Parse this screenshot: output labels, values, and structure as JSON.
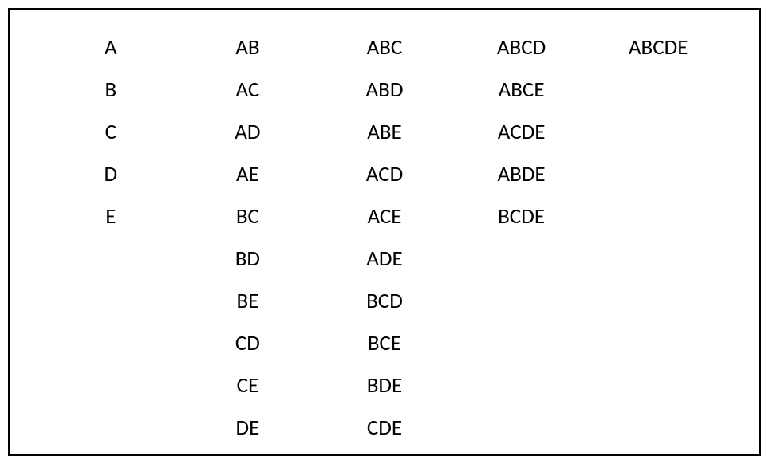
{
  "columns": [
    {
      "items": [
        "A",
        "B",
        "C",
        "D",
        "E"
      ]
    },
    {
      "items": [
        "AB",
        "AC",
        "AD",
        "AE",
        "BC",
        "BD",
        "BE",
        "CD",
        "CE",
        "DE"
      ]
    },
    {
      "items": [
        "ABC",
        "ABD",
        "ABE",
        "ACD",
        "ACE",
        "ADE",
        "BCD",
        "BCE",
        "BDE",
        "CDE"
      ]
    },
    {
      "items": [
        "ABCD",
        "ABCE",
        "ACDE",
        "ABDE",
        "BCDE"
      ]
    },
    {
      "items": [
        "ABCDE"
      ]
    }
  ]
}
